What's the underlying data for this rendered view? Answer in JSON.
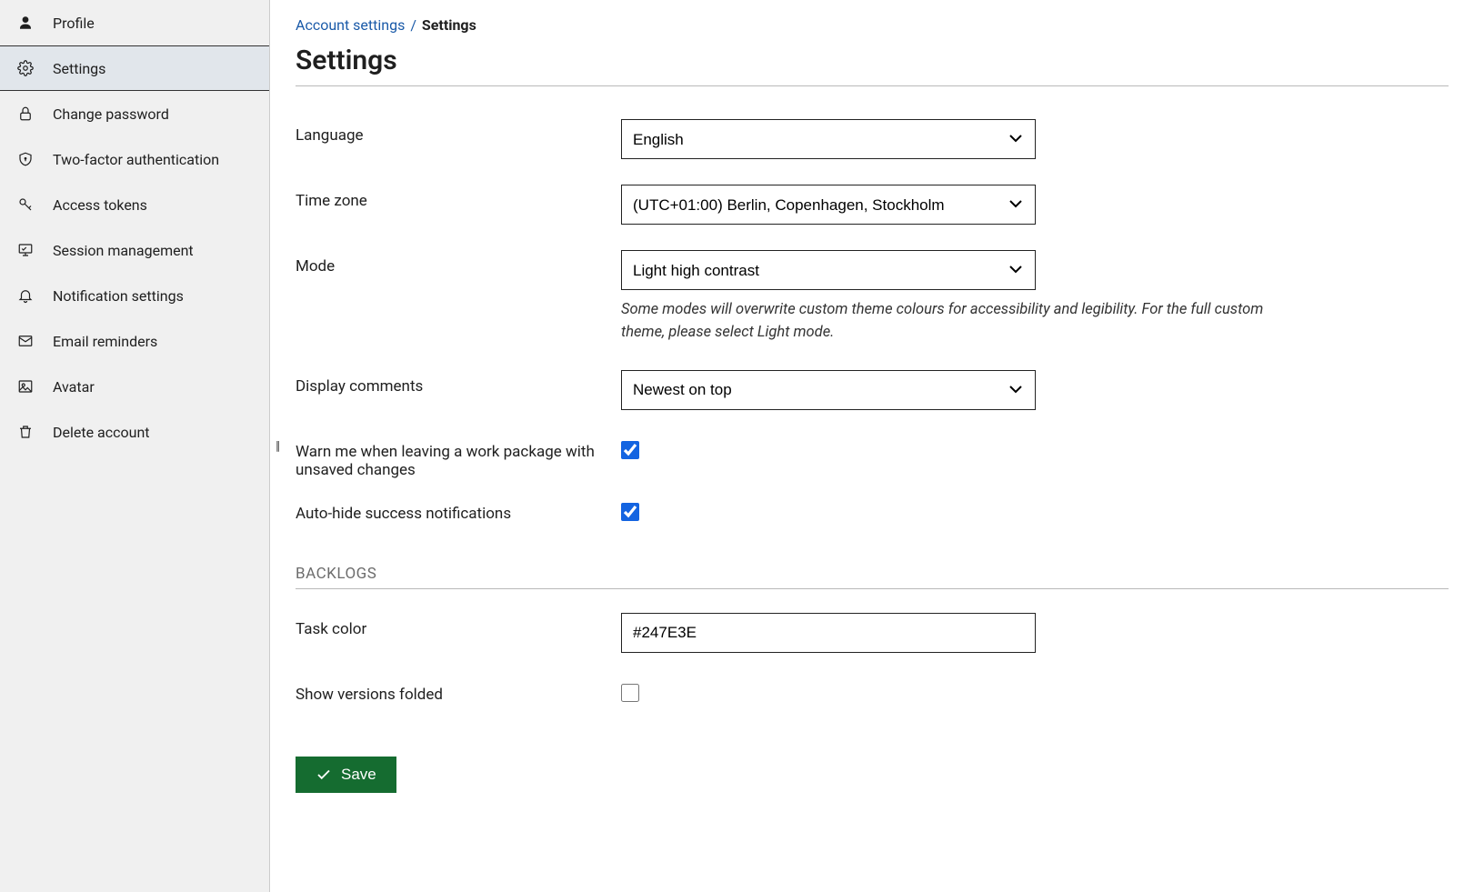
{
  "sidebar": {
    "items": [
      {
        "label": "Profile"
      },
      {
        "label": "Settings"
      },
      {
        "label": "Change password"
      },
      {
        "label": "Two-factor authentication"
      },
      {
        "label": "Access tokens"
      },
      {
        "label": "Session management"
      },
      {
        "label": "Notification settings"
      },
      {
        "label": "Email reminders"
      },
      {
        "label": "Avatar"
      },
      {
        "label": "Delete account"
      }
    ]
  },
  "breadcrumb": {
    "parent": "Account settings",
    "separator": "/",
    "current": "Settings"
  },
  "page": {
    "title": "Settings"
  },
  "form": {
    "language": {
      "label": "Language",
      "value": "English"
    },
    "timezone": {
      "label": "Time zone",
      "value": "(UTC+01:00) Berlin, Copenhagen, Stockholm"
    },
    "mode": {
      "label": "Mode",
      "value": "Light high contrast",
      "help": "Some modes will overwrite custom theme colours for accessibility and legibility. For the full custom theme, please select Light mode."
    },
    "comments": {
      "label": "Display comments",
      "value": "Newest on top"
    },
    "warn_unsaved": {
      "label": "Warn me when leaving a work package with unsaved changes",
      "checked": true
    },
    "autohide": {
      "label": "Auto-hide success notifications",
      "checked": true
    },
    "backlogs_heading": "BACKLOGS",
    "task_color": {
      "label": "Task color",
      "value": "#247E3E"
    },
    "versions_folded": {
      "label": "Show versions folded",
      "checked": false
    },
    "save_label": "Save"
  }
}
